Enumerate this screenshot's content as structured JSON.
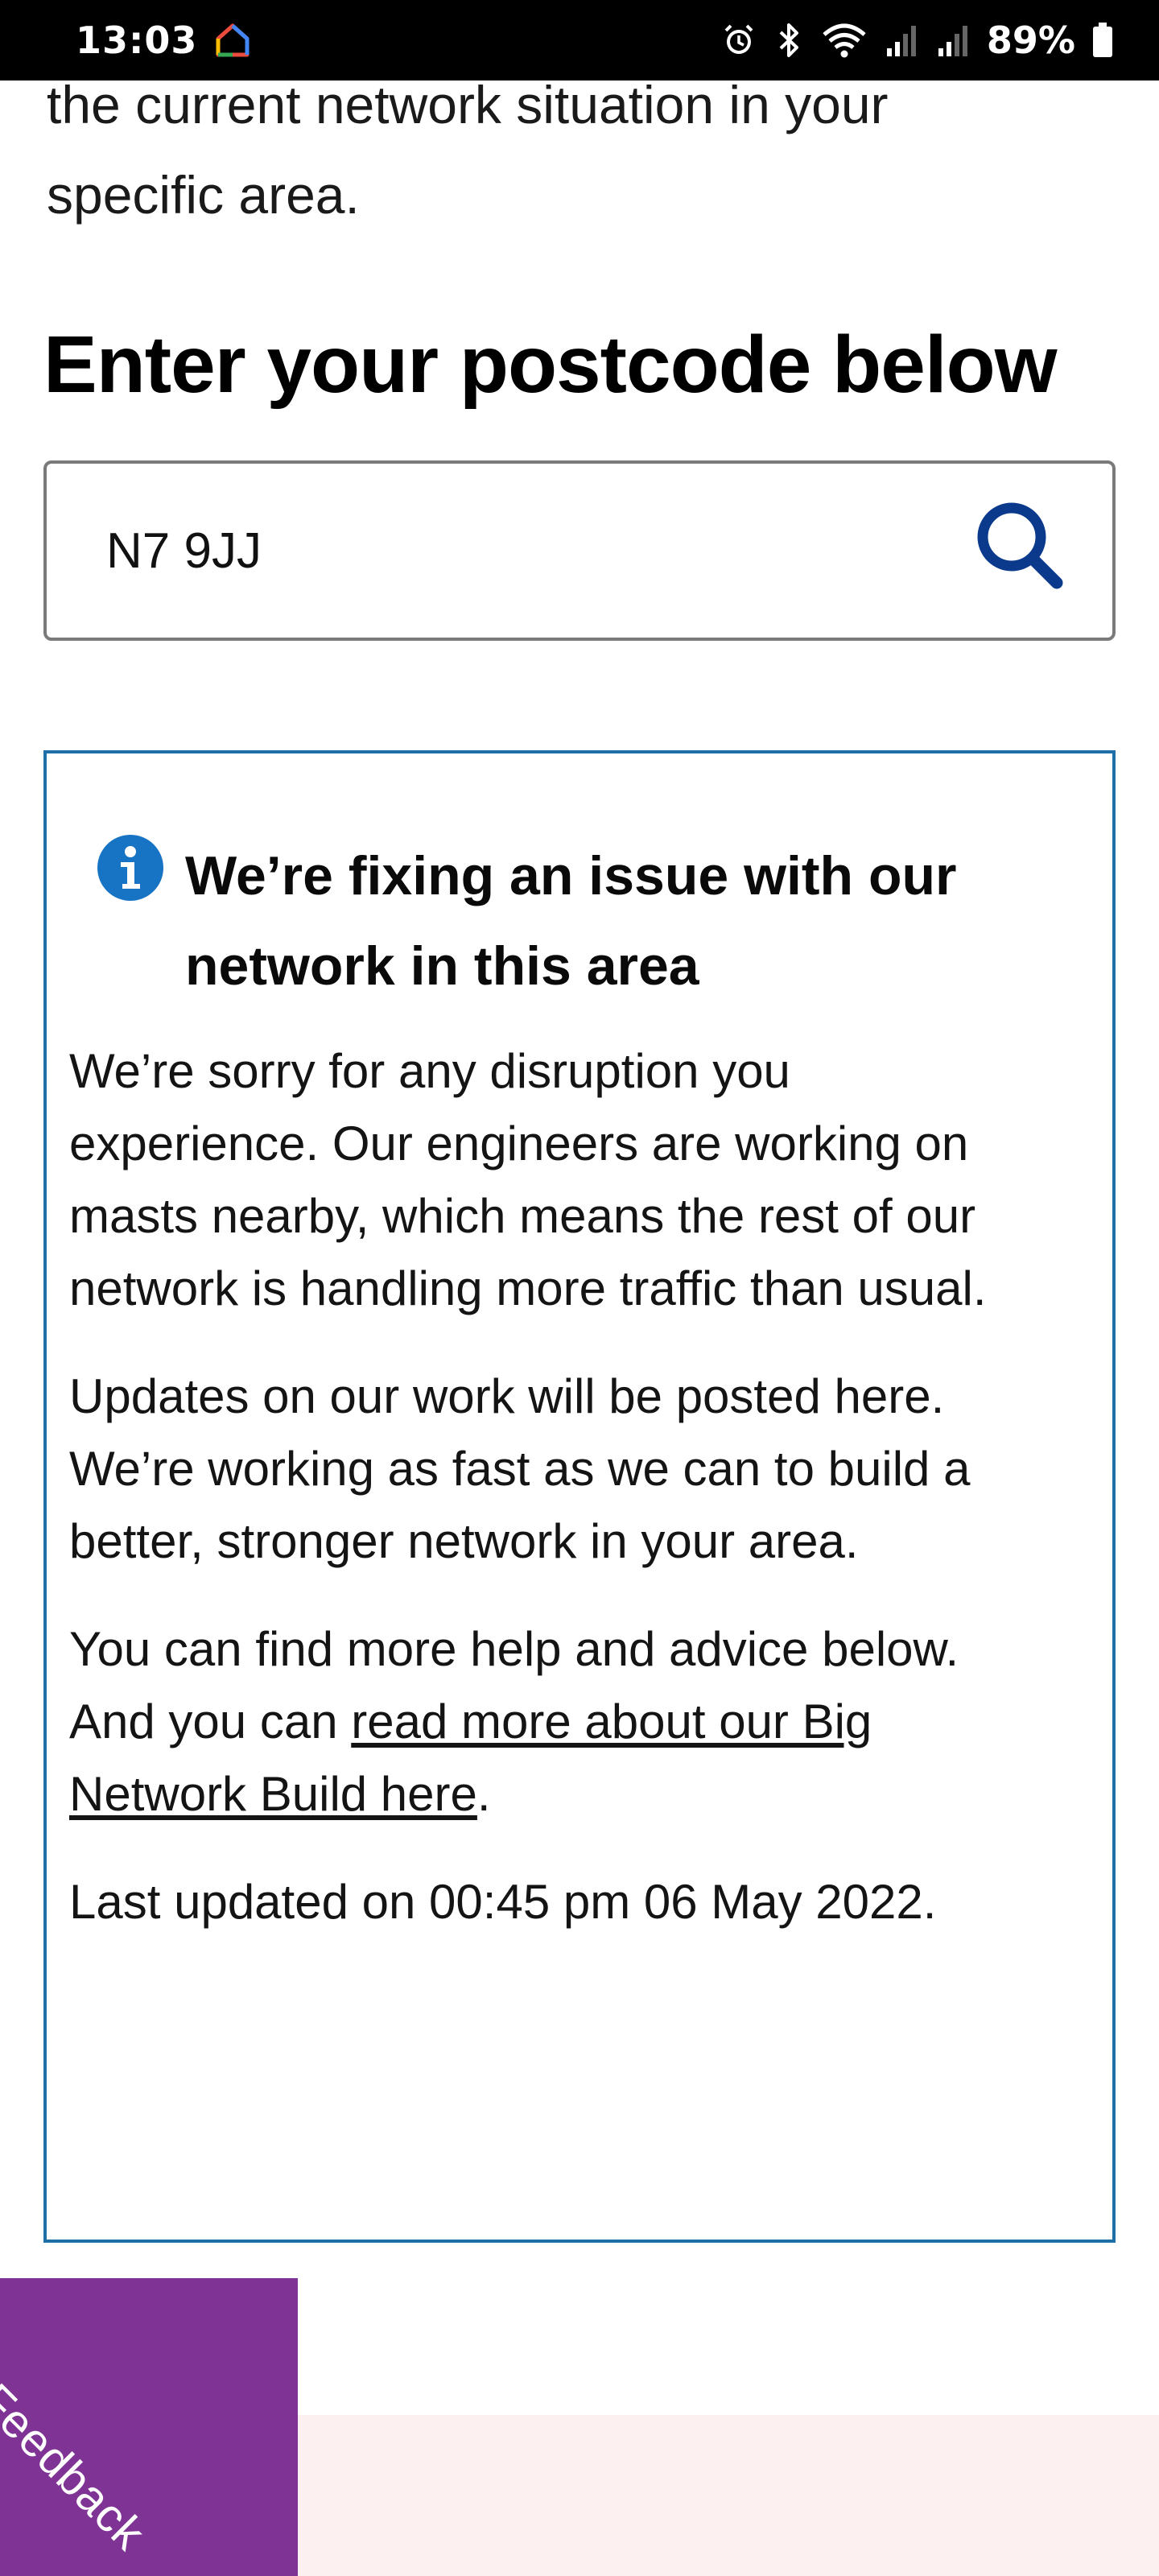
{
  "status_bar": {
    "time": "13:03",
    "battery": "89%",
    "icons": [
      "home-app-icon",
      "alarm-icon",
      "bluetooth-icon",
      "wifi-icon",
      "signal-icon",
      "signal-icon",
      "battery-icon"
    ]
  },
  "intro": {
    "line1": "the current network situation in your",
    "line2": "specific area."
  },
  "postcode": {
    "heading": "Enter your postcode below",
    "value": "N7 9JJ",
    "search_icon": "search-icon"
  },
  "alert": {
    "icon": "info-icon",
    "title": "We’re fixing an issue with our network in this area",
    "para1": "We’re sorry for any disruption you experience. Our engineers are working on masts nearby, which means the rest of our network is handling more traffic than usual.",
    "para2": "Updates on our work will be posted here. We’re working as fast as we can to build a better, stronger network in your area.",
    "para3_before": "You can find more help and advice below. And you can ",
    "para3_link": "read more about our Big Network Build here",
    "para3_after": ".",
    "last_updated": "Last updated on 00:45 pm 06 May 2022."
  },
  "feedback": {
    "label": "Feedback"
  },
  "colors": {
    "accent_blue": "#0b3a8c",
    "info_blue": "#1773c4",
    "alert_border": "#1d6fa5",
    "feedback_purple": "#7e3395",
    "footer_pink": "#fdf0f0"
  }
}
